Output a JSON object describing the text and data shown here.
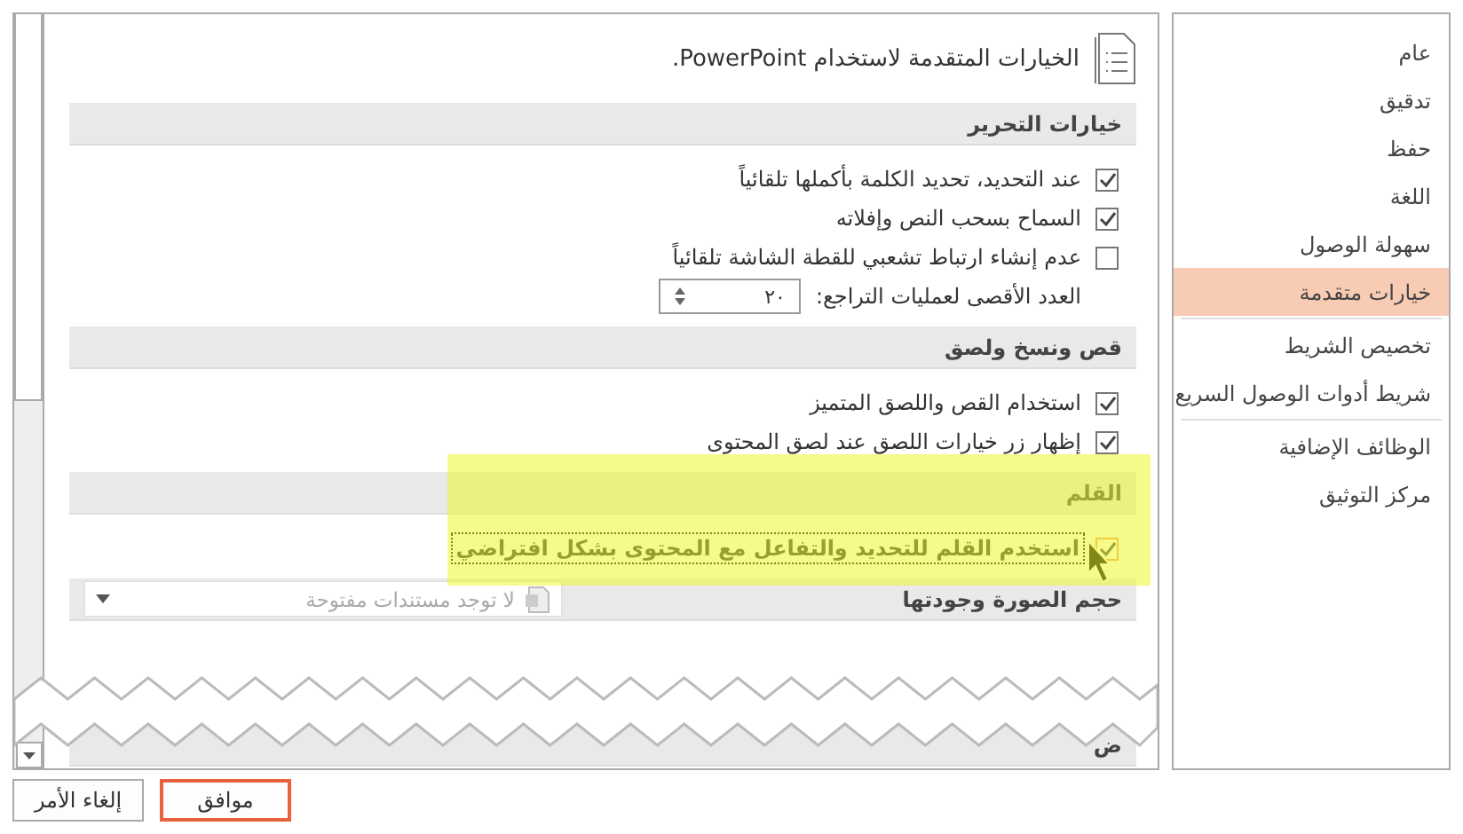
{
  "sidebar": {
    "items": [
      {
        "label": "عام",
        "selected": false,
        "divider_after": false
      },
      {
        "label": "تدقيق",
        "selected": false,
        "divider_after": false
      },
      {
        "label": "حفظ",
        "selected": false,
        "divider_after": false
      },
      {
        "label": "اللغة",
        "selected": false,
        "divider_after": false
      },
      {
        "label": "سهولة الوصول",
        "selected": false,
        "divider_after": false
      },
      {
        "label": "خيارات متقدمة",
        "selected": true,
        "divider_after": true
      },
      {
        "label": "تخصيص الشريط",
        "selected": false,
        "divider_after": false
      },
      {
        "label": "شريط أدوات الوصول السريع",
        "selected": false,
        "divider_after": true
      },
      {
        "label": "الوظائف الإضافية",
        "selected": false,
        "divider_after": false
      },
      {
        "label": "مركز التوثيق",
        "selected": false,
        "divider_after": false
      }
    ]
  },
  "header": {
    "title": "الخيارات المتقدمة لاستخدام PowerPoint."
  },
  "sections": [
    {
      "title": "خيارات التحرير",
      "highlighted": false,
      "options": [
        {
          "kind": "checkbox",
          "label": "عند التحديد، تحديد الكلمة بأكملها تلقائياً",
          "checked": true,
          "focused": false
        },
        {
          "kind": "checkbox",
          "label": "السماح بسحب النص وإفلاته",
          "checked": true,
          "focused": false
        },
        {
          "kind": "checkbox",
          "label": "عدم إنشاء ارتباط تشعبي للقطة الشاشة تلقائياً",
          "checked": false,
          "focused": false
        },
        {
          "kind": "spinner",
          "label": "العدد الأقصى لعمليات التراجع:",
          "value": "٢٠"
        }
      ]
    },
    {
      "title": "قص ونسخ ولصق",
      "highlighted": false,
      "options": [
        {
          "kind": "checkbox",
          "label": "استخدام القص واللصق المتميز",
          "checked": true,
          "focused": false
        },
        {
          "kind": "checkbox",
          "label": "إظهار زر خيارات اللصق عند لصق المحتوى",
          "checked": true,
          "focused": false
        }
      ]
    },
    {
      "title": "القلم",
      "highlighted": true,
      "options": [
        {
          "kind": "checkbox",
          "label": "استخدم القلم للتحديد والتفاعل مع المحتوى بشكل افتراضي",
          "checked": true,
          "focused": true
        }
      ]
    }
  ],
  "image_section": {
    "title": "حجم الصورة وجودتها",
    "dropdown": {
      "placeholder": "لا توجد مستندات مفتوحة"
    }
  },
  "cut_section": {
    "title": "ض"
  },
  "buttons": [
    {
      "label": "موافق",
      "highlighted": true
    },
    {
      "label": "إلغاء الأمر",
      "highlighted": false
    }
  ]
}
